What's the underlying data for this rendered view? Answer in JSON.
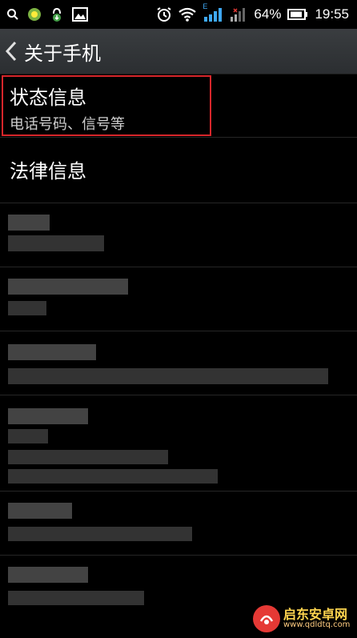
{
  "statusbar": {
    "battery_percent": "64%",
    "time": "19:55",
    "network_label": "E",
    "icons": [
      "search-icon",
      "app-green-icon",
      "download-icon",
      "image-icon",
      "alarm-icon",
      "wifi-icon",
      "signal-icon",
      "signal-icon-2",
      "battery-icon"
    ]
  },
  "actionbar": {
    "title": "关于手机"
  },
  "list": {
    "items": [
      {
        "title": "状态信息",
        "subtitle": "电话号码、信号等"
      },
      {
        "title": "法律信息"
      }
    ]
  },
  "watermark": {
    "line1": "启东安卓网",
    "line2": "www.qdldtq.com"
  },
  "colors": {
    "highlight": "#d7262b",
    "background": "#000000"
  }
}
